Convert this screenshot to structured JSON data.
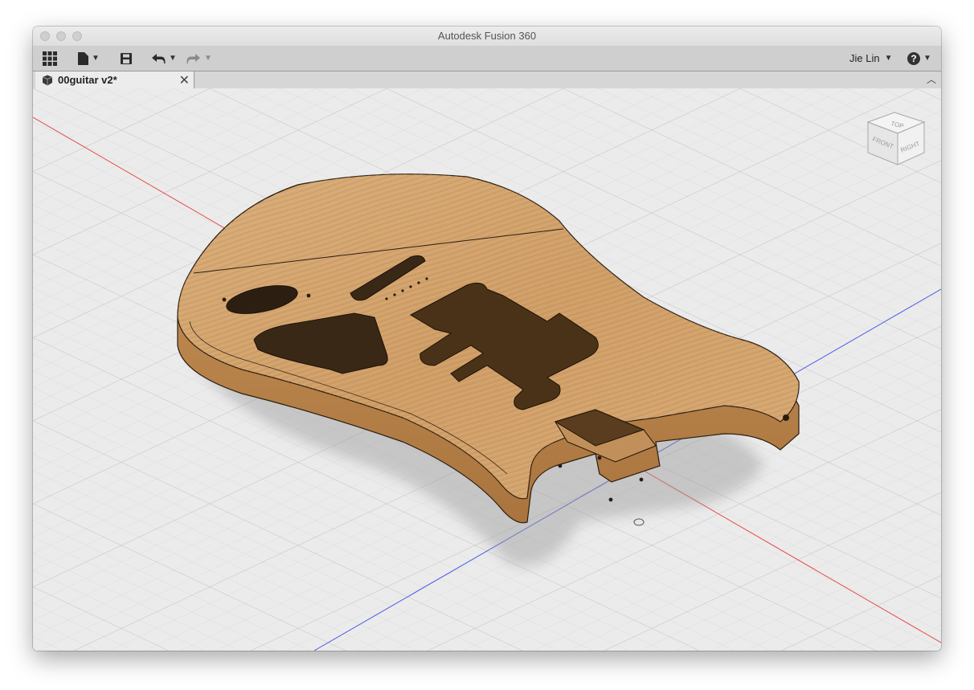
{
  "window": {
    "title": "Autodesk Fusion 360"
  },
  "toolbar": {
    "user_name": "Jie Lin",
    "icons": [
      "grid-icon",
      "file-icon",
      "save-icon",
      "undo-icon",
      "redo-icon",
      "help-icon"
    ]
  },
  "tab": {
    "title": "00guitar v2*"
  },
  "viewcube": {
    "top": "TOP",
    "front": "FRONT",
    "right": "RIGHT"
  },
  "colors": {
    "x_axis": "#e84a4a",
    "z_axis": "#4a5ae8",
    "wood": "#d2a06c",
    "grid": "#c8c8c8"
  }
}
